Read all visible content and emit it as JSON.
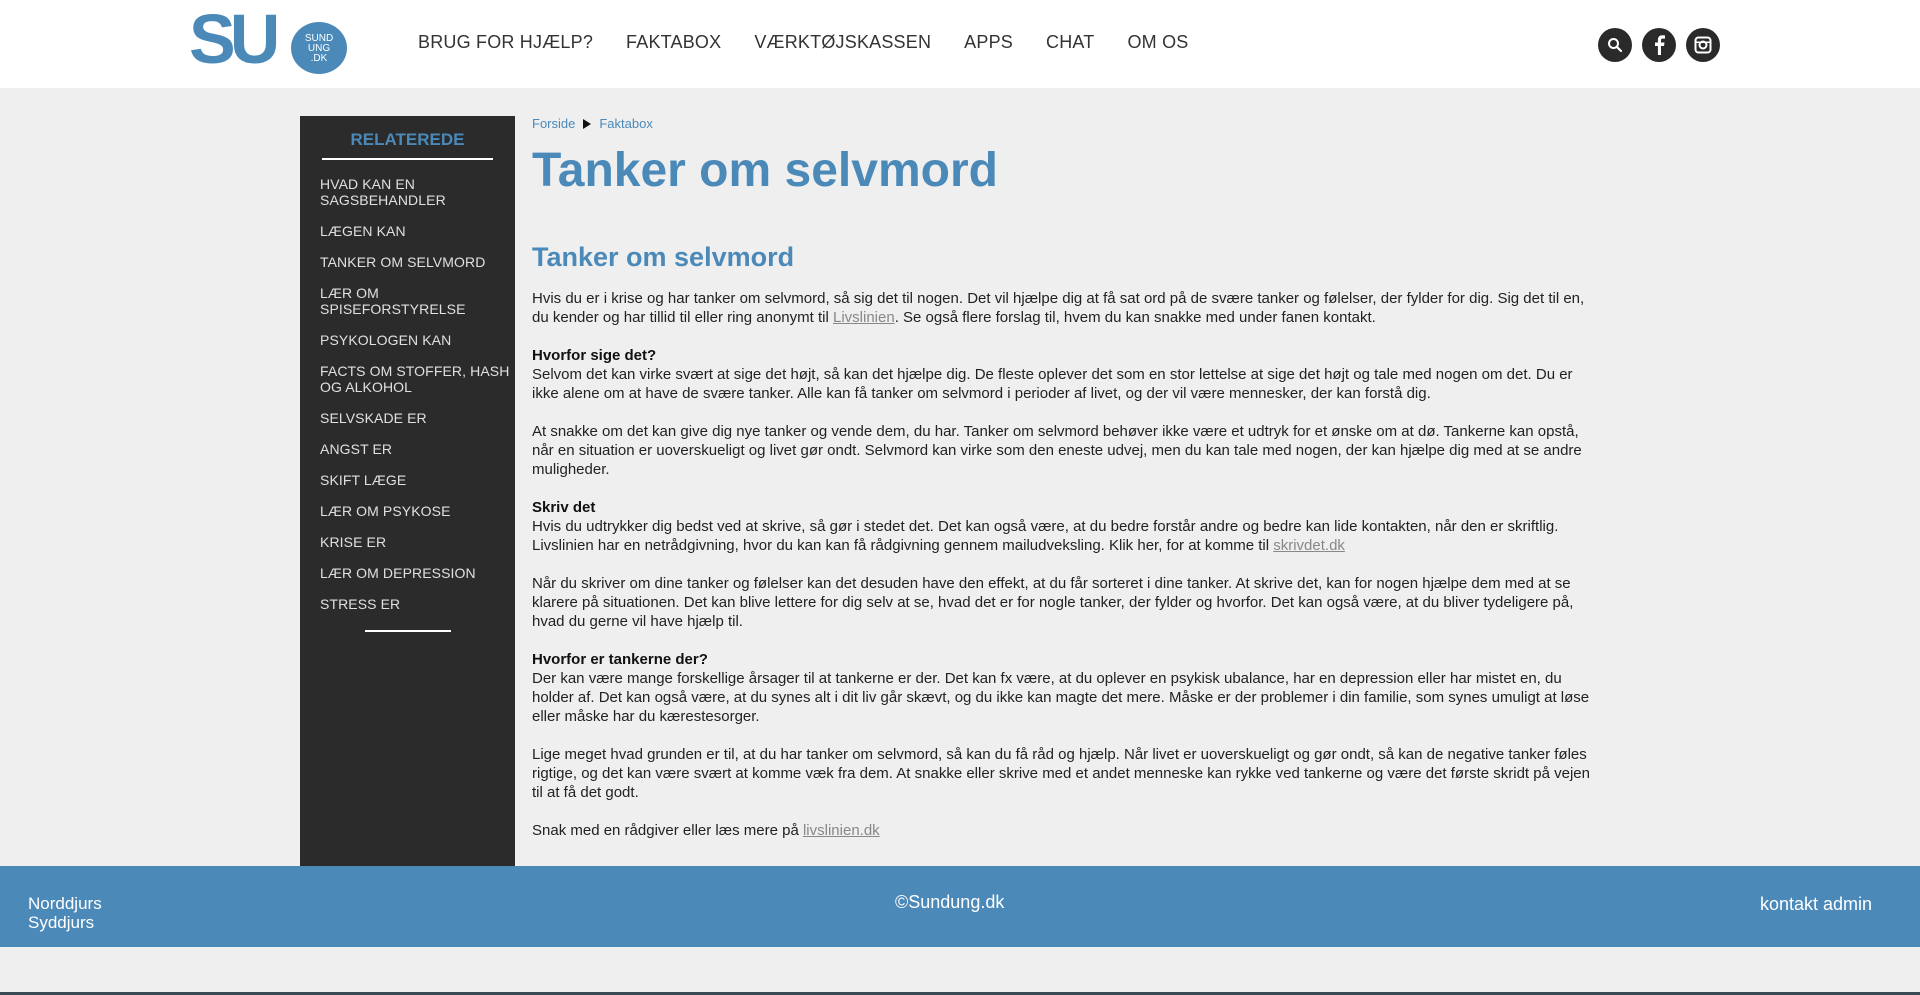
{
  "logo": {
    "letters": "SU",
    "bubble_lines": [
      "SUND",
      "UNG",
      ".DK"
    ]
  },
  "nav": {
    "items": [
      "BRUG FOR HJÆLP?",
      "FAKTABOX",
      "VÆRKTØJSKASSEN",
      "APPS",
      "CHAT",
      "OM OS"
    ]
  },
  "social": {
    "icons": [
      "search-icon",
      "facebook-icon",
      "instagram-icon"
    ]
  },
  "sidebar": {
    "title": "RELATEREDE",
    "items": [
      "HVAD KAN EN SAGSBEHANDLER",
      "LÆGEN KAN",
      "TANKER OM SELVMORD",
      "LÆR OM SPISEFORSTYRELSE",
      "PSYKOLOGEN KAN",
      "FACTS OM STOFFER, HASH OG ALKOHOL",
      "SELVSKADE ER",
      "ANGST ER",
      "SKIFT LÆGE",
      "LÆR OM PSYKOSE",
      "KRISE ER",
      "LÆR OM DEPRESSION",
      "STRESS ER"
    ]
  },
  "breadcrumb": {
    "home": "Forside",
    "current": "Faktabox"
  },
  "page": {
    "title": "Tanker om selvmord",
    "subtitle": "Tanker om selvmord"
  },
  "article": {
    "p1_a": "Hvis du er i krise og har tanker om selvmord, så sig det til nogen. Det vil hjælpe dig at få sat ord på de svære tanker og følelser, der fylder for dig. Sig det til en, du kender og har tillid til eller ring anonymt til ",
    "p1_link": "Livslinien",
    "p1_b": ". Se også flere forslag til, hvem du kan snakke med under fanen kontakt.",
    "h2": "Hvorfor sige det?",
    "p2": "Selvom det kan virke svært at sige det højt, så kan det hjælpe dig. De fleste oplever det som en stor lettelse at sige det højt og tale med nogen om det. Du er ikke alene om at have de svære tanker. Alle kan få tanker om selvmord i perioder af livet, og der vil være mennesker, der kan forstå dig.",
    "p3": "At snakke om det kan give dig nye tanker og vende dem, du har. Tanker om selvmord behøver ikke være et udtryk for et ønske om at dø. Tankerne kan opstå, når en situation er uoverskueligt og livet gør ondt. Selvmord kan virke som den eneste udvej, men du kan tale med nogen, der kan hjælpe dig med at se andre muligheder.",
    "h4": "Skriv det",
    "p4_a": "Hvis du udtrykker dig bedst ved at skrive, så gør i stedet det. Det kan også være, at du bedre forstår andre og bedre kan lide kontakten, når den er skriftlig. Livslinien har en netrådgivning, hvor du kan kan få rådgivning gennem mailudveksling. Klik her, for at komme til ",
    "p4_link": "skrivdet.dk",
    "p5": "Når du skriver om dine tanker og følelser kan det desuden have den effekt, at du får sorteret i dine tanker. At skrive det, kan for nogen hjælpe dem med at se klarere på situationen. Det kan blive lettere for dig selv at se, hvad det er for nogle tanker, der fylder og hvorfor. Det kan også være, at du bliver tydeligere på, hvad du gerne vil have hjælp til.",
    "h6": "Hvorfor er tankerne der?",
    "p6": "Der kan være mange forskellige årsager til at tankerne er der. Det kan fx være, at du oplever en psykisk ubalance, har en depression eller har mistet en, du holder af. Det kan også være, at du synes alt i dit liv går skævt, og du ikke kan magte det mere. Måske er der problemer i din familie, som synes umuligt at løse eller måske har du kærestesorger.",
    "p7": "Lige meget hvad grunden er til, at du har tanker om selvmord, så kan du få råd og hjælp. Når livet er uoverskueligt og gør ondt, så kan de negative tanker føles rigtige, og det kan være svært at komme væk fra dem. At snakke eller skrive med et andet menneske kan rykke ved tankerne og være det første skridt på vejen til at få det godt.",
    "p8_a": "Snak med en rådgiver eller læs mere på ",
    "p8_link": "livslinien.dk"
  },
  "footer": {
    "left_line1": "Norddjurs",
    "left_line2": "Syddjurs",
    "center": "©Sundung.dk",
    "right": "kontakt admin"
  },
  "colors": {
    "brand_blue": "#4a89b8",
    "sidebar_bg": "#2b2b2b",
    "page_bg": "#efefef"
  }
}
